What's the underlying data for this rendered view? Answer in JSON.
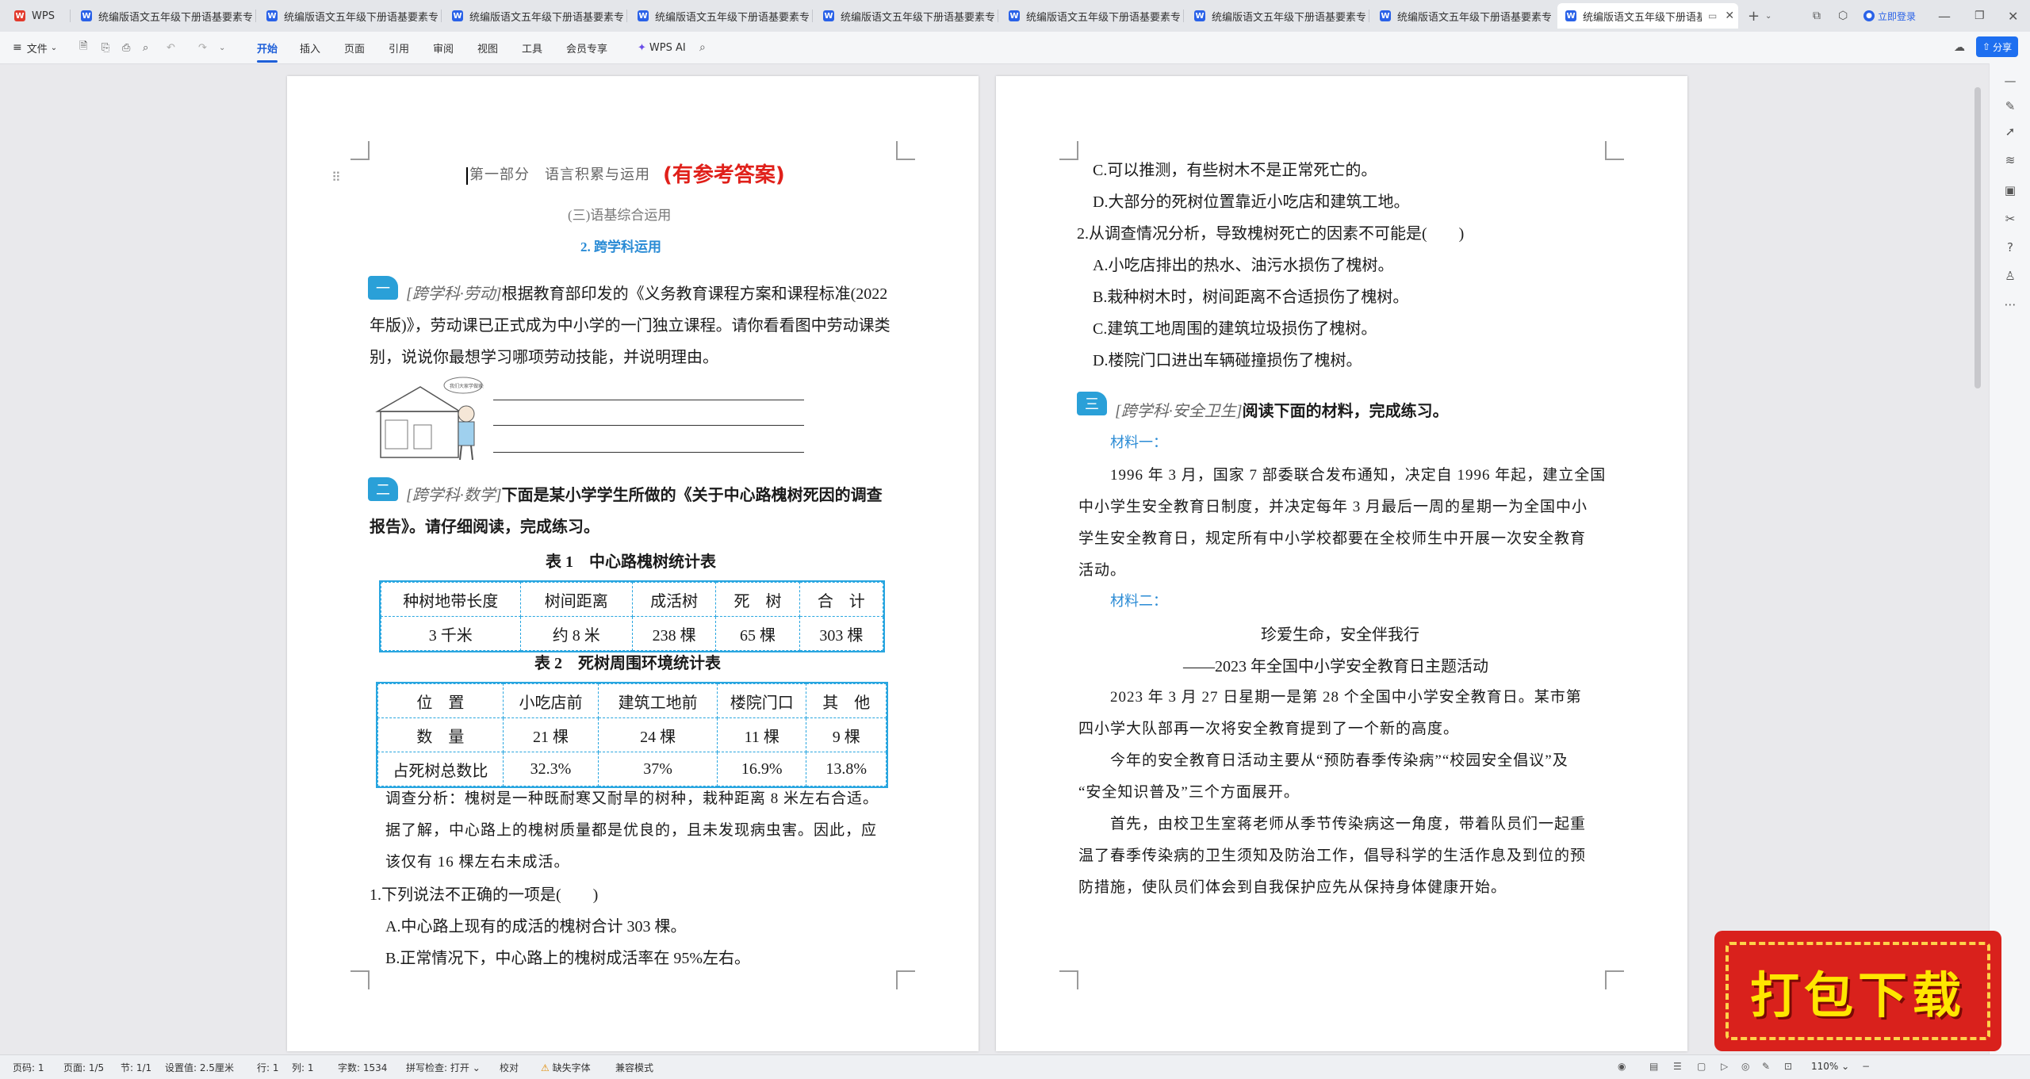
{
  "tabs": {
    "home": "WPS",
    "doc_title": "统编版语文五年级下册语基要素专练",
    "doc_title_active": "统编版语文五年级下册语基要"
  },
  "account": {
    "login": "立即登录",
    "share": "分享"
  },
  "toolbar": {
    "file": "文件",
    "menus": [
      "开始",
      "插入",
      "页面",
      "引用",
      "审阅",
      "视图",
      "工具",
      "会员专享"
    ],
    "ai": "WPS AI"
  },
  "page1": {
    "header_part": "第一部分　语言积累与运用",
    "header_answer": "(有参考答案)",
    "subtitle": "(三)语基综合运用",
    "section": "2. 跨学科运用",
    "q1_badge": "一",
    "q1_tag": "[跨学科·劳动]",
    "q1_line1_rest": "根据教育部印发的《义务教育课程方案和课程标准(2022",
    "q1_line2": "年版)》，劳动课已正式成为中小学的一门独立课程。请你看看图中劳动课类",
    "q1_line3": "别，说说你最想学习哪项劳动技能，并说明理由。",
    "illus_bubble": "我们大家学做家务!",
    "q2_badge": "二",
    "q2_tag": "[跨学科·数学]",
    "q2_line1_rest": "下面是某小学学生所做的《关于中心路槐树死因的调查",
    "q2_line2": "报告》。请仔细阅读，完成练习。",
    "table1_title": "表 1　中心路槐树统计表",
    "table1": {
      "header": [
        "种树地带长度",
        "树间距离",
        "成活树",
        "死　树",
        "合　计"
      ],
      "row": [
        "3 千米",
        "约 8 米",
        "238 棵",
        "65 棵",
        "303 棵"
      ]
    },
    "table2_title": "表 2　死树周围环境统计表",
    "table2": {
      "header": [
        "位　置",
        "小吃店前",
        "建筑工地前",
        "楼院门口",
        "其　他"
      ],
      "row1": [
        "数　量",
        "21 棵",
        "24 棵",
        "11 棵",
        "9 棵"
      ],
      "row2": [
        "占死树总数比",
        "32.3%",
        "37%",
        "16.9%",
        "13.8%"
      ]
    },
    "analysis": [
      "调查分析：槐树是一种既耐寒又耐旱的树种，栽种距离 8 米左右合适。",
      "据了解，中心路上的槐树质量都是优良的，且未发现病虫害。因此，应",
      "该仅有 16 棵左右未成活。"
    ],
    "sq1": "1.下列说法不正确的一项是(　　)",
    "sq1_a": "A.中心路上现有的成活的槐树合计 303 棵。",
    "sq1_b": "B.正常情况下，中心路上的槐树成活率在 95%左右。"
  },
  "page2": {
    "opt_c": "C.可以推测，有些树木不是正常死亡的。",
    "opt_d": "D.大部分的死树位置靠近小吃店和建筑工地。",
    "sq2": "2.从调查情况分析，导致槐树死亡的因素不可能是(　　)",
    "sq2_opts": [
      "A.小吃店排出的热水、油污水损伤了槐树。",
      "B.栽种树木时，树间距离不合适损伤了槐树。",
      "C.建筑工地周围的建筑垃圾损伤了槐树。",
      "D.楼院门口进出车辆碰撞损伤了槐树。"
    ],
    "q3_badge": "三",
    "q3_tag": "[跨学科·安全卫生]",
    "q3_rest": "阅读下面的材料，完成练习。",
    "mat1": "材料一：",
    "mat1_text": [
      "1996 年 3 月，国家 7 部委联合发布通知，决定自 1996 年起，建立全国",
      "中小学生安全教育日制度，并决定每年 3 月最后一周的星期一为全国中小",
      "学生安全教育日，规定所有中小学校都要在全校师生中开展一次安全教育",
      "活动。"
    ],
    "mat2": "材料二：",
    "title2": "珍爱生命，安全伴我行",
    "subtitle2": "——2023 年全国中小学安全教育日主题活动",
    "para": [
      "2023 年 3 月 27 日星期一是第 28 个全国中小学安全教育日。某市第",
      "四小学大队部再一次将安全教育提到了一个新的高度。",
      "今年的安全教育日活动主要从“预防春季传染病”“校园安全倡议”及",
      "“安全知识普及”三个方面展开。",
      "首先，由校卫生室蒋老师从季节传染病这一角度，带着队员们一起重",
      "温了春季传染病的卫生须知及防治工作，倡导科学的生活作息及到位的预",
      "防措施，使队员们体会到自我保护应先从保持身体健康开始。"
    ]
  },
  "status": {
    "page_no": "页码: 1",
    "pages": "页面: 1/5",
    "section": "节: 1/1",
    "setting": "设置值: 2.5厘米",
    "row": "行: 1",
    "col": "列: 1",
    "words": "字数: 1534",
    "spell": "拼写检查: 打开",
    "proof": "校对",
    "missing_font": "缺失字体",
    "compat": "兼容模式",
    "zoom": "110%"
  },
  "banner": {
    "text": "打包下载"
  }
}
